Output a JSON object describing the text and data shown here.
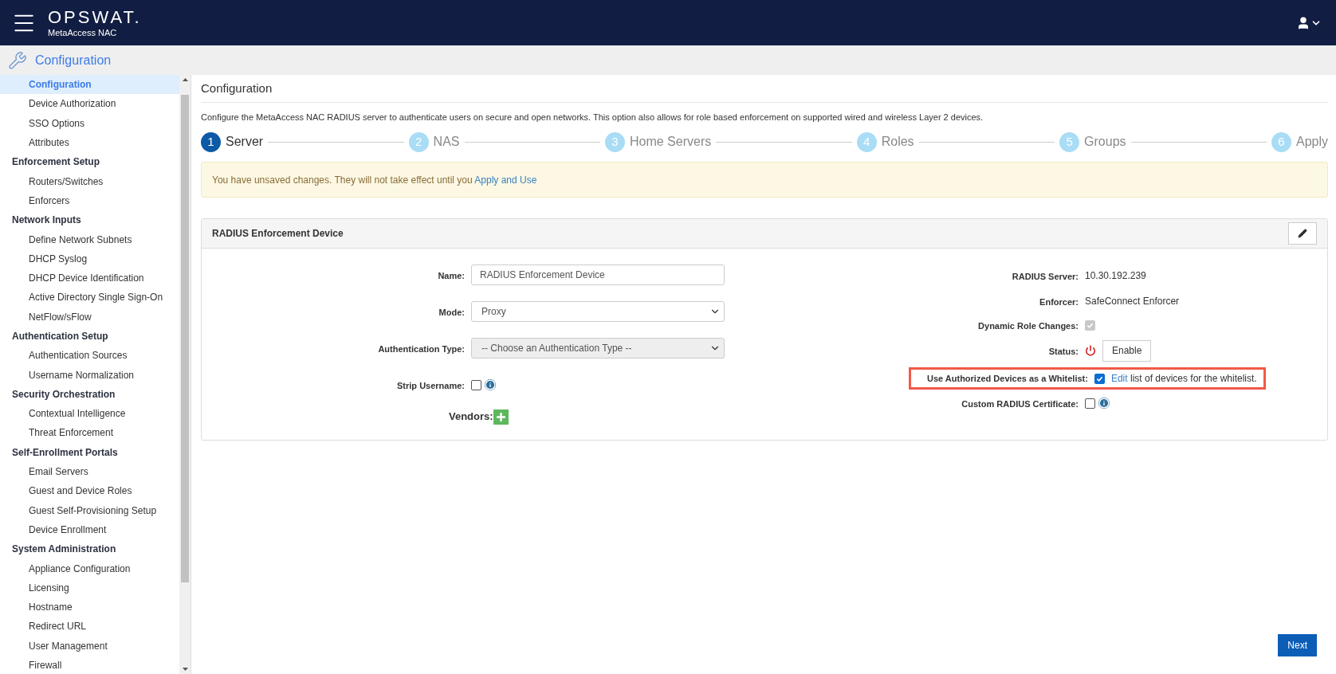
{
  "header": {
    "brand": "OPSWAT.",
    "product": "MetaAccess NAC"
  },
  "section": {
    "title": "Configuration"
  },
  "sidebar": {
    "items": [
      {
        "label": "Configuration",
        "kind": "link",
        "selected": true
      },
      {
        "label": "Device Authorization",
        "kind": "link",
        "selected": false
      },
      {
        "label": "SSO Options",
        "kind": "link",
        "selected": false
      },
      {
        "label": "Attributes",
        "kind": "link",
        "selected": false
      },
      {
        "label": "Enforcement Setup",
        "kind": "group"
      },
      {
        "label": "Routers/Switches",
        "kind": "link",
        "selected": false
      },
      {
        "label": "Enforcers",
        "kind": "link",
        "selected": false
      },
      {
        "label": "Network Inputs",
        "kind": "group"
      },
      {
        "label": "Define Network Subnets",
        "kind": "link",
        "selected": false
      },
      {
        "label": "DHCP Syslog",
        "kind": "link",
        "selected": false
      },
      {
        "label": "DHCP Device Identification",
        "kind": "link",
        "selected": false
      },
      {
        "label": "Active Directory Single Sign-On",
        "kind": "link",
        "selected": false
      },
      {
        "label": "NetFlow/sFlow",
        "kind": "link",
        "selected": false
      },
      {
        "label": "Authentication Setup",
        "kind": "group"
      },
      {
        "label": "Authentication Sources",
        "kind": "link",
        "selected": false
      },
      {
        "label": "Username Normalization",
        "kind": "link",
        "selected": false
      },
      {
        "label": "Security Orchestration",
        "kind": "group"
      },
      {
        "label": "Contextual Intelligence",
        "kind": "link",
        "selected": false
      },
      {
        "label": "Threat Enforcement",
        "kind": "link",
        "selected": false
      },
      {
        "label": "Self-Enrollment Portals",
        "kind": "group"
      },
      {
        "label": "Email Servers",
        "kind": "link",
        "selected": false
      },
      {
        "label": "Guest and Device Roles",
        "kind": "link",
        "selected": false
      },
      {
        "label": "Guest Self-Provisioning Setup",
        "kind": "link",
        "selected": false
      },
      {
        "label": "Device Enrollment",
        "kind": "link",
        "selected": false
      },
      {
        "label": "System Administration",
        "kind": "group"
      },
      {
        "label": "Appliance Configuration",
        "kind": "link",
        "selected": false
      },
      {
        "label": "Licensing",
        "kind": "link",
        "selected": false
      },
      {
        "label": "Hostname",
        "kind": "link",
        "selected": false
      },
      {
        "label": "Redirect URL",
        "kind": "link",
        "selected": false
      },
      {
        "label": "User Management",
        "kind": "link",
        "selected": false
      },
      {
        "label": "Firewall",
        "kind": "link",
        "selected": false
      }
    ]
  },
  "page": {
    "title": "Configuration",
    "description": "Configure the MetaAccess NAC RADIUS server to authenticate users on secure and open networks. This option also allows for role based enforcement on supported wired and wireless Layer 2 devices."
  },
  "steps": [
    {
      "number": "1",
      "label": "Server",
      "selected": true
    },
    {
      "number": "2",
      "label": "NAS",
      "selected": false
    },
    {
      "number": "3",
      "label": "Home Servers",
      "selected": false
    },
    {
      "number": "4",
      "label": "Roles",
      "selected": false
    },
    {
      "number": "5",
      "label": "Groups",
      "selected": false
    },
    {
      "number": "6",
      "label": "Apply",
      "selected": false
    }
  ],
  "alert": {
    "text": "You have unsaved changes. They will not take effect until you",
    "link": "Apply and Use"
  },
  "panel": {
    "title": "RADIUS Enforcement Device",
    "left_fields": [
      {
        "kind": "text",
        "label": "Name:",
        "value": "RADIUS Enforcement Device",
        "disabled": false
      },
      {
        "kind": "select",
        "label": "Mode:",
        "value": "Proxy",
        "disabled": false
      },
      {
        "kind": "select",
        "label": "Authentication Type:",
        "value": "-- Choose an Authentication Type --",
        "disabled": true
      },
      {
        "kind": "checkbox",
        "label": "Strip Username:",
        "checked": false,
        "info": true
      },
      {
        "kind": "add",
        "label": "Vendors:"
      }
    ],
    "right_fields": [
      {
        "kind": "value",
        "label": "RADIUS Server:",
        "value": "10.30.192.239"
      },
      {
        "kind": "value",
        "label": "Enforcer:",
        "value": "SafeConnect Enforcer"
      },
      {
        "kind": "checkbox",
        "label": "Dynamic Role Changes:",
        "checked": true,
        "disabled": true
      },
      {
        "kind": "status",
        "label": "Status:",
        "button": "Enable"
      },
      {
        "kind": "checkbox_link",
        "label": "Use Authorized Devices as a Whitelist:",
        "checked": true,
        "highlighted": true,
        "link": "Edit",
        "text": "list of devices for the whitelist."
      },
      {
        "kind": "checkbox",
        "label": "Custom RADIUS Certificate:",
        "checked": false,
        "info": true
      }
    ]
  },
  "footer": {
    "button": "Next"
  }
}
